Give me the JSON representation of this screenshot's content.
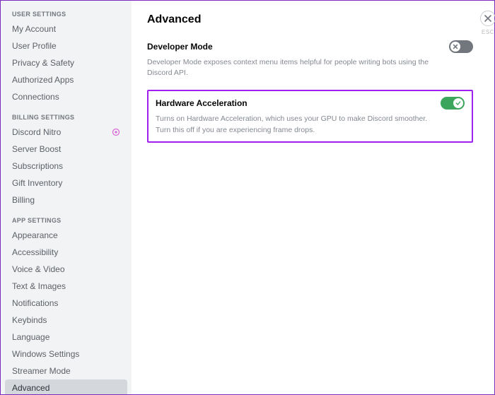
{
  "sidebar": {
    "sections": [
      {
        "header": "USER SETTINGS",
        "items": [
          {
            "label": "My Account"
          },
          {
            "label": "User Profile"
          },
          {
            "label": "Privacy & Safety"
          },
          {
            "label": "Authorized Apps"
          },
          {
            "label": "Connections"
          }
        ]
      },
      {
        "header": "BILLING SETTINGS",
        "items": [
          {
            "label": "Discord Nitro",
            "badge": true
          },
          {
            "label": "Server Boost"
          },
          {
            "label": "Subscriptions"
          },
          {
            "label": "Gift Inventory"
          },
          {
            "label": "Billing"
          }
        ]
      },
      {
        "header": "APP SETTINGS",
        "items": [
          {
            "label": "Appearance"
          },
          {
            "label": "Accessibility"
          },
          {
            "label": "Voice & Video"
          },
          {
            "label": "Text & Images"
          },
          {
            "label": "Notifications"
          },
          {
            "label": "Keybinds"
          },
          {
            "label": "Language"
          },
          {
            "label": "Windows Settings"
          },
          {
            "label": "Streamer Mode"
          },
          {
            "label": "Advanced",
            "active": true
          }
        ]
      }
    ]
  },
  "page": {
    "title": "Advanced",
    "close_hint": "ESC"
  },
  "settings": {
    "developer_mode": {
      "title": "Developer Mode",
      "desc": "Developer Mode exposes context menu items helpful for people writing bots using the Discord API.",
      "enabled": false
    },
    "hardware_acceleration": {
      "title": "Hardware Acceleration",
      "desc": "Turns on Hardware Acceleration, which uses your GPU to make Discord smoother. Turn this off if you are experiencing frame drops.",
      "enabled": true
    }
  }
}
